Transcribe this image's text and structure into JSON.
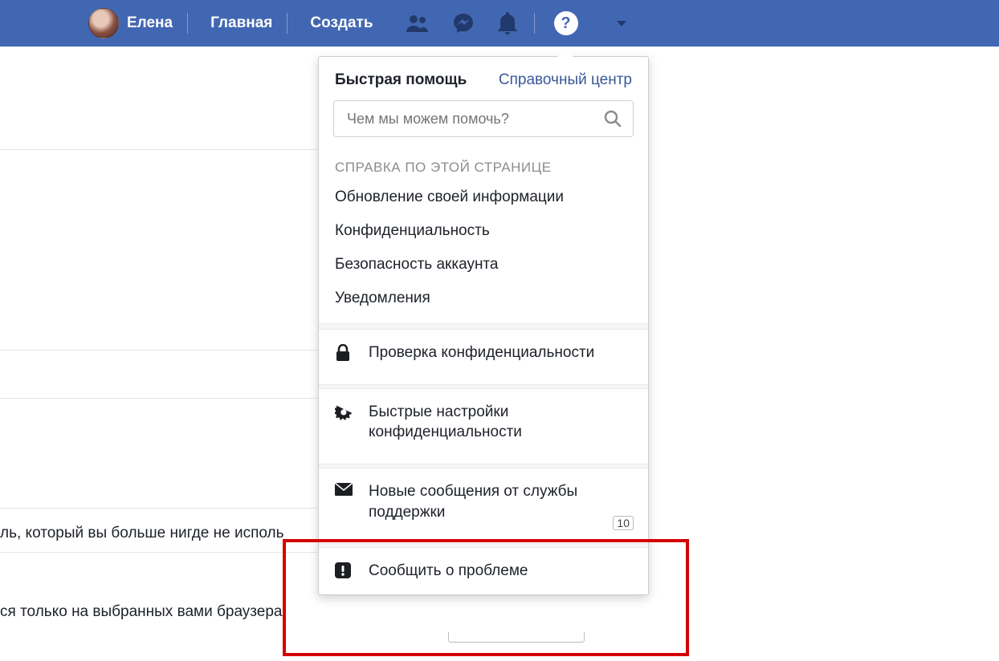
{
  "header": {
    "username": "Елена",
    "home": "Главная",
    "create": "Создать"
  },
  "popover": {
    "title": "Быстрая помощь",
    "help_center": "Справочный центр",
    "search_placeholder": "Чем мы можем помочь?",
    "section_label": "СПРАВКА ПО ЭТОЙ СТРАНИЦЕ",
    "topics": [
      "Обновление своей информации",
      "Конфиденциальность",
      "Безопасность аккаунта",
      "Уведомления"
    ],
    "privacy_checkup": "Проверка конфиденциальности",
    "privacy_shortcuts": "Быстрые настройки конфиденциальности",
    "support_inbox": "Новые сообщения от службы поддержки",
    "support_badge": "10",
    "report_problem": "Сообщить о проблеме"
  },
  "background": {
    "line1": "ль, который вы больше нигде не исполь",
    "line2": "ся только на выбранных вами браузера"
  }
}
